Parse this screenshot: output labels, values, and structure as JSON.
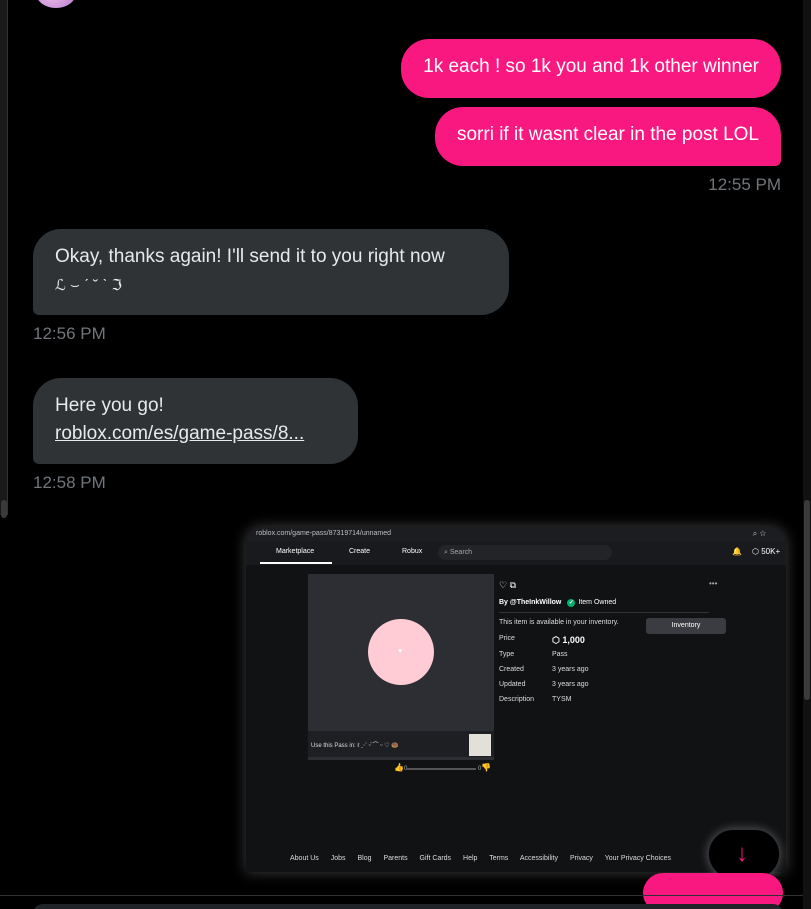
{
  "header": {
    "name": ""
  },
  "messages": [
    {
      "side": "sent",
      "text": "1k each ! so 1k you and 1k other winner"
    },
    {
      "side": "sent",
      "text": "sorri if it wasnt clear in the post LOL"
    },
    {
      "side": "sent",
      "time": "12:55 PM"
    },
    {
      "side": "received",
      "text": "Okay, thanks again! I'll send it to you right now",
      "emoticon": "ℒ ⌣ ˊ ˘ ˋ ℑ"
    },
    {
      "side": "received",
      "time": "12:56 PM"
    },
    {
      "side": "received",
      "text": "Here you go!",
      "link": "roblox.com/es/game-pass/8..."
    },
    {
      "side": "received",
      "time": "12:58 PM"
    }
  ],
  "screenshot": {
    "url": "roblox.com/game-pass/87319714/unnamed",
    "nav": {
      "marketplace": "Marketplace",
      "create": "Create",
      "robux": "Robux",
      "search_placeholder": "Search",
      "robux_balance": "50K+"
    },
    "item": {
      "by": "By @TheInkWillow",
      "owned": "Item Owned",
      "available": "This item is available in your inventory.",
      "inventory_button": "Inventory",
      "rows": [
        {
          "label": "Price",
          "value": "1,000"
        },
        {
          "label": "Type",
          "value": "Pass"
        },
        {
          "label": "Created",
          "value": "3 years ago"
        },
        {
          "label": "Updated",
          "value": "3 years ago"
        },
        {
          "label": "Description",
          "value": "TYSM"
        }
      ],
      "use_text": "Use this Pass in: ℓ ⋰ ᵕ̈ ⌒ ᵕ ♡ 🍩",
      "likes": "0",
      "dislikes": "0"
    },
    "footer": [
      "About Us",
      "Jobs",
      "Blog",
      "Parents",
      "Gift Cards",
      "Help",
      "Terms",
      "Accessibility",
      "Privacy",
      "Your Privacy Choices"
    ]
  },
  "icons": {
    "scroll_down": "arrow-down-icon",
    "accent": "#f91880"
  }
}
